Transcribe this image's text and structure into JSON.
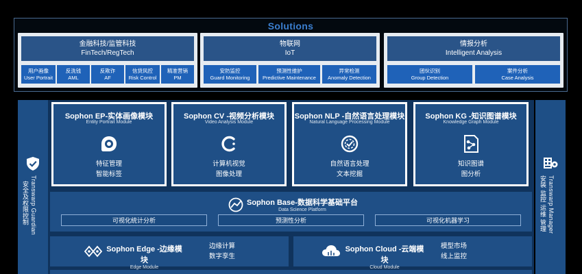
{
  "solutions": {
    "title": "Solutions",
    "groups": [
      {
        "cn": "金融科技/监管科技",
        "en": "FinTech/RegTech",
        "items": [
          {
            "cn": "用户画像",
            "en": "User Portrait"
          },
          {
            "cn": "反洗钱",
            "en": "AML"
          },
          {
            "cn": "反欺诈",
            "en": "AF"
          },
          {
            "cn": "信贷风控",
            "en": "Risk Control"
          },
          {
            "cn": "精准营销",
            "en": "PM"
          }
        ]
      },
      {
        "cn": "物联网",
        "en": "IoT",
        "items": [
          {
            "cn": "安防监控",
            "en": "Guard Monitoring"
          },
          {
            "cn": "预测性维护",
            "en": "Predictive Maintenance"
          },
          {
            "cn": "异常检测",
            "en": "Anomaly Detection"
          }
        ]
      },
      {
        "cn": "情报分析",
        "en": "Intelligent Analysis",
        "items": [
          {
            "cn": "团伙识别",
            "en": "Group Detection"
          },
          {
            "cn": "案件分析",
            "en": "Case Analysis"
          }
        ]
      }
    ]
  },
  "left_side": {
    "en": "Transwarp Guardian",
    "cn": "安全及权限控制",
    "icon": "shield-check-icon"
  },
  "right_side": {
    "en": "Transwarp Manager",
    "cn": "安装 监控 运维 管理",
    "icon": "manager-grid-icon"
  },
  "modules": [
    {
      "title": "Sophon EP-实体画像模块",
      "sub": "Entity Portrait Module",
      "icon": "portrait-icon",
      "features": [
        "特征管理",
        "智能标签"
      ]
    },
    {
      "title": "Sophon CV -视频分析模块",
      "sub": "Video Analysis Module",
      "icon": "cv-icon",
      "features": [
        "计算机视觉",
        "图像处理"
      ]
    },
    {
      "title": "Sophon NLP -自然语言处理模块",
      "sub": "Natural Language Processing Module",
      "icon": "nlp-icon",
      "features": [
        "自然语言处理",
        "文本挖掘"
      ]
    },
    {
      "title": "Sophon KG -知识图谱模块",
      "sub": "Knowledge Graph Module",
      "icon": "knowledge-graph-icon",
      "features": [
        "知识图谱",
        "图分析"
      ]
    }
  ],
  "base": {
    "title": "Sophon Base-数据科学基础平台",
    "sub": "Data Science Platform",
    "icon": "data-science-icon",
    "features": [
      "可视化统计分析",
      "预测性分析",
      "可视化机器学习"
    ]
  },
  "edge": {
    "title": "Sophon Edge -边缘模块",
    "sub": "Edge Module",
    "icon": "edge-icon",
    "features": [
      "边缘计算",
      "数字孪生"
    ]
  },
  "cloud": {
    "title": "Sophon Cloud -云端模块",
    "sub": "Cloud Module",
    "icon": "cloud-icon",
    "features": [
      "模型市场",
      "线上监控"
    ]
  }
}
